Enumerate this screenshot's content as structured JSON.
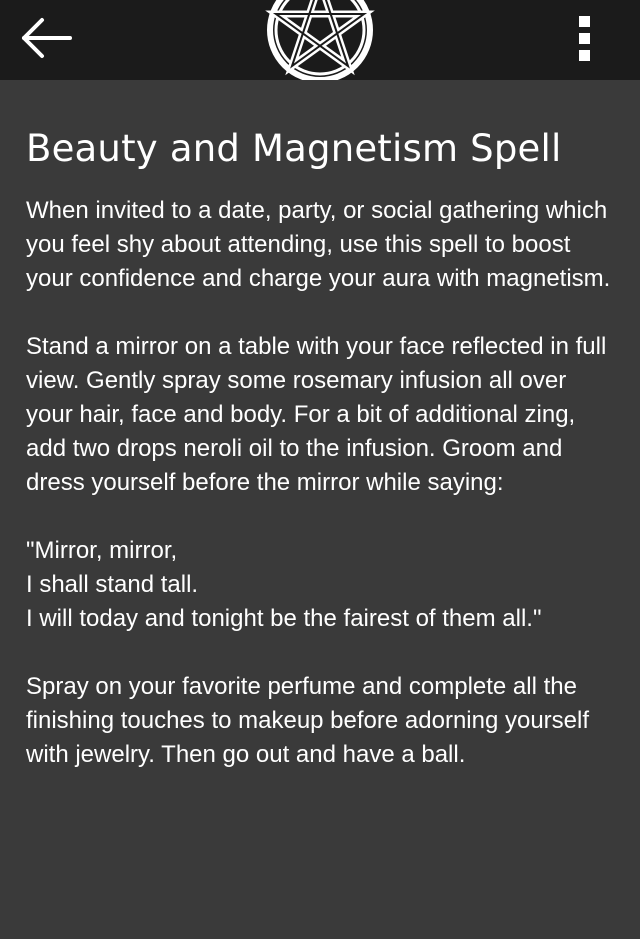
{
  "header": {
    "back_icon": "arrow-left-icon",
    "logo_icon": "pentagram-icon",
    "menu_icon": "more-vertical-icon"
  },
  "page": {
    "title": "Beauty and Magnetism Spell",
    "paragraphs": [
      "When invited to a date, party, or social gathering which you feel shy about attending, use this spell to boost your confidence and charge your aura with magnetism.",
      "Stand a mirror on a table with your face reflected in full view. Gently spray some rosemary infusion all over your hair, face and body. For a bit of additional zing, add two drops neroli oil to the infusion. Groom and dress yourself before the mirror while saying:",
      "\"Mirror, mirror,\nI shall stand tall.\nI will today and tonight be the fairest of them all.\"",
      "Spray on your favorite perfume and complete all the finishing touches to makeup before adorning yourself with jewelry. Then go out and have a ball."
    ]
  },
  "colors": {
    "header_bg": "#1b1b1b",
    "body_bg": "#3a3a3a",
    "text": "#ffffff"
  }
}
